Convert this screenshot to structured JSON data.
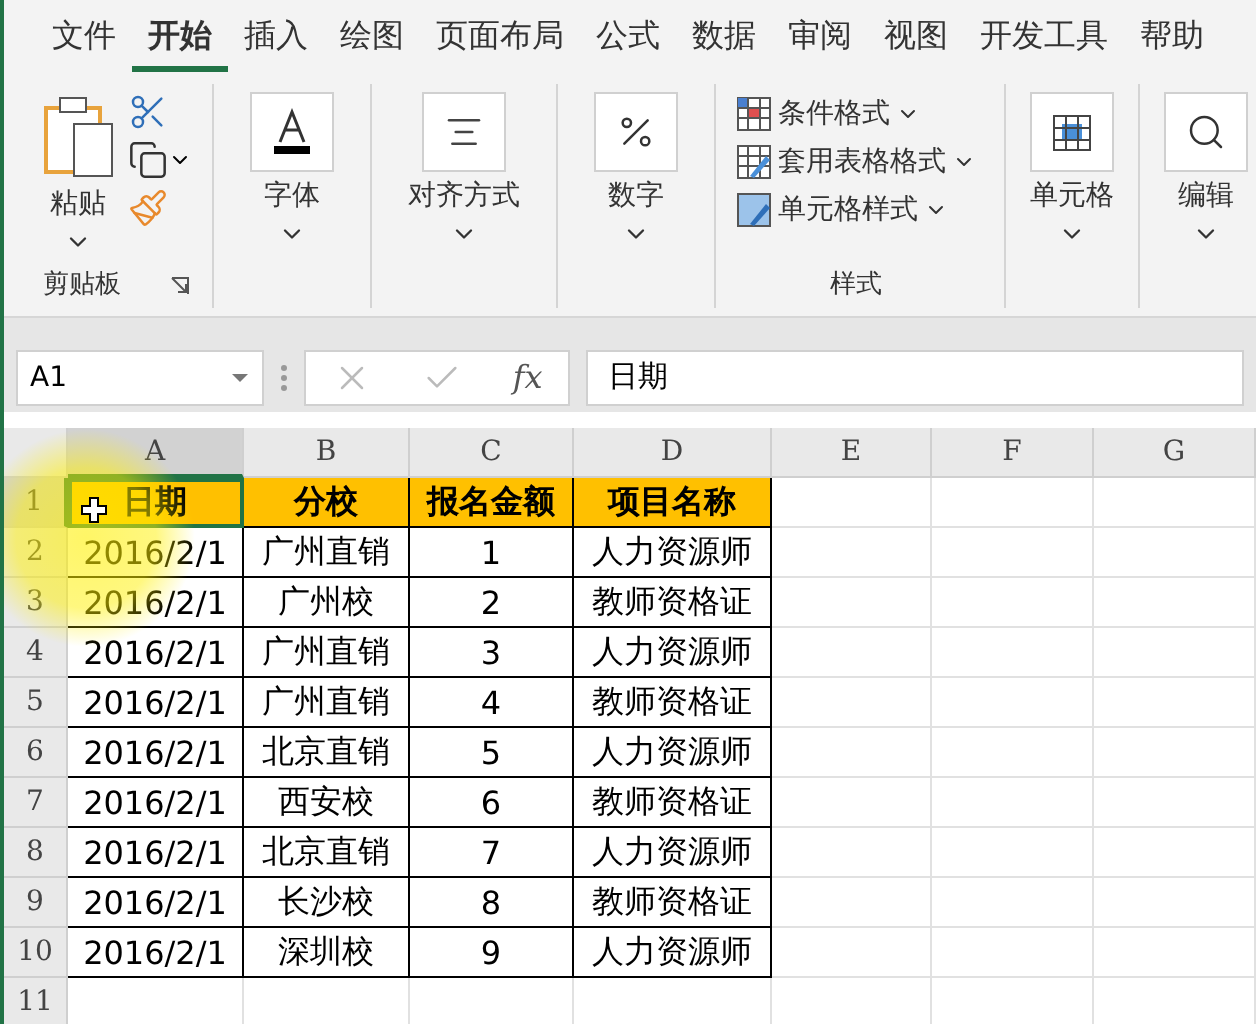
{
  "tabs": [
    {
      "label": "文件",
      "selected": false
    },
    {
      "label": "开始",
      "selected": true
    },
    {
      "label": "插入",
      "selected": false
    },
    {
      "label": "绘图",
      "selected": false
    },
    {
      "label": "页面布局",
      "selected": false
    },
    {
      "label": "公式",
      "selected": false
    },
    {
      "label": "数据",
      "selected": false
    },
    {
      "label": "审阅",
      "selected": false
    },
    {
      "label": "视图",
      "selected": false
    },
    {
      "label": "开发工具",
      "selected": false
    },
    {
      "label": "帮助",
      "selected": false
    }
  ],
  "ribbon": {
    "clipboard": {
      "paste": "粘贴",
      "label": "剪贴板"
    },
    "groups": [
      {
        "kind": "font",
        "label": "字体"
      },
      {
        "kind": "align",
        "label": "对齐方式"
      },
      {
        "kind": "number",
        "label": "数字"
      }
    ],
    "styles": {
      "items": [
        {
          "kind": "conditional",
          "label": "条件格式"
        },
        {
          "kind": "table",
          "label": "套用表格格式"
        },
        {
          "kind": "cell",
          "label": "单元格样式"
        }
      ],
      "label": "样式"
    },
    "tail": [
      {
        "kind": "cells",
        "label": "单元格"
      },
      {
        "kind": "edit",
        "label": "编辑"
      }
    ]
  },
  "formula_bar": {
    "name_box": "A1",
    "fx": "fx",
    "value": "日期"
  },
  "sheet": {
    "columns": [
      {
        "label": "A",
        "selected": true
      },
      {
        "label": "B",
        "selected": false
      },
      {
        "label": "C",
        "selected": false
      },
      {
        "label": "D",
        "selected": false
      },
      {
        "label": "E",
        "selected": false
      },
      {
        "label": "F",
        "selected": false
      },
      {
        "label": "G",
        "selected": false
      }
    ],
    "rows": [
      {
        "number": "1",
        "selected": true,
        "kind": "header",
        "cells": [
          "日期",
          "分校",
          "报名金额",
          "项目名称"
        ]
      },
      {
        "number": "2",
        "selected": false,
        "kind": "data",
        "cells": [
          "2016/2/1",
          "广州直销",
          "1",
          "人力资源师"
        ]
      },
      {
        "number": "3",
        "selected": false,
        "kind": "data",
        "cells": [
          "2016/2/1",
          "广州校",
          "2",
          "教师资格证"
        ]
      },
      {
        "number": "4",
        "selected": false,
        "kind": "data",
        "cells": [
          "2016/2/1",
          "广州直销",
          "3",
          "人力资源师"
        ]
      },
      {
        "number": "5",
        "selected": false,
        "kind": "data",
        "cells": [
          "2016/2/1",
          "广州直销",
          "4",
          "教师资格证"
        ]
      },
      {
        "number": "6",
        "selected": false,
        "kind": "data",
        "cells": [
          "2016/2/1",
          "北京直销",
          "5",
          "人力资源师"
        ]
      },
      {
        "number": "7",
        "selected": false,
        "kind": "data",
        "cells": [
          "2016/2/1",
          "西安校",
          "6",
          "教师资格证"
        ]
      },
      {
        "number": "8",
        "selected": false,
        "kind": "data",
        "cells": [
          "2016/2/1",
          "北京直销",
          "7",
          "人力资源师"
        ]
      },
      {
        "number": "9",
        "selected": false,
        "kind": "data",
        "cells": [
          "2016/2/1",
          "长沙校",
          "8",
          "教师资格证"
        ]
      },
      {
        "number": "10",
        "selected": false,
        "kind": "data",
        "cells": [
          "2016/2/1",
          "深圳校",
          "9",
          "人力资源师"
        ]
      },
      {
        "number": "11",
        "selected": false,
        "kind": "empty",
        "cells": []
      }
    ]
  }
}
